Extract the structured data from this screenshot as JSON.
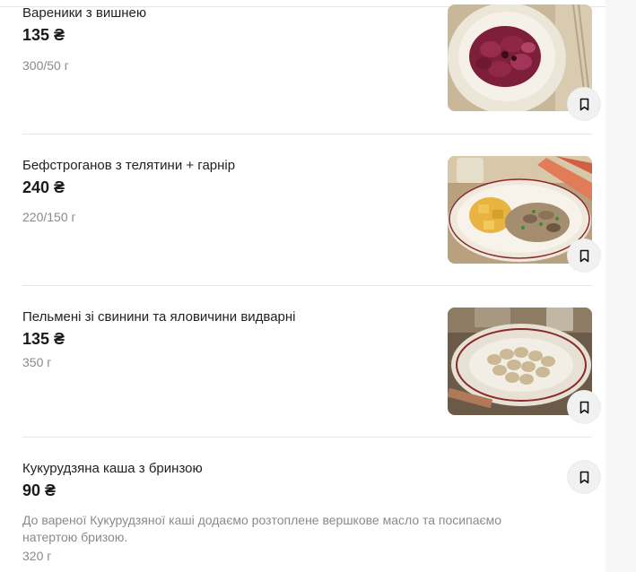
{
  "currency": "₴",
  "items": [
    {
      "name": "Вареники з вишнею",
      "price": "135 ₴",
      "weight": "300/50 г",
      "image": "cherry-vareniki-photo"
    },
    {
      "name": "Бефстроганов з телятини + гарнір",
      "price": "240 ₴",
      "weight": "220/150 г",
      "image": "beef-stroganoff-photo"
    },
    {
      "name": "Пельмені зі свинини та яловичини видварні",
      "price": "135 ₴",
      "weight": "350 г",
      "image": "pelmeni-photo"
    },
    {
      "name": "Кукурудзяна каша з бринзою",
      "price": "90 ₴",
      "weight": "320 г",
      "description": "До вареної Кукурудзяної каші додаємо розтоплене вершкове масло та посипаємо натертою бризою."
    }
  ],
  "icons": {
    "favorite": "bookmark-icon"
  }
}
